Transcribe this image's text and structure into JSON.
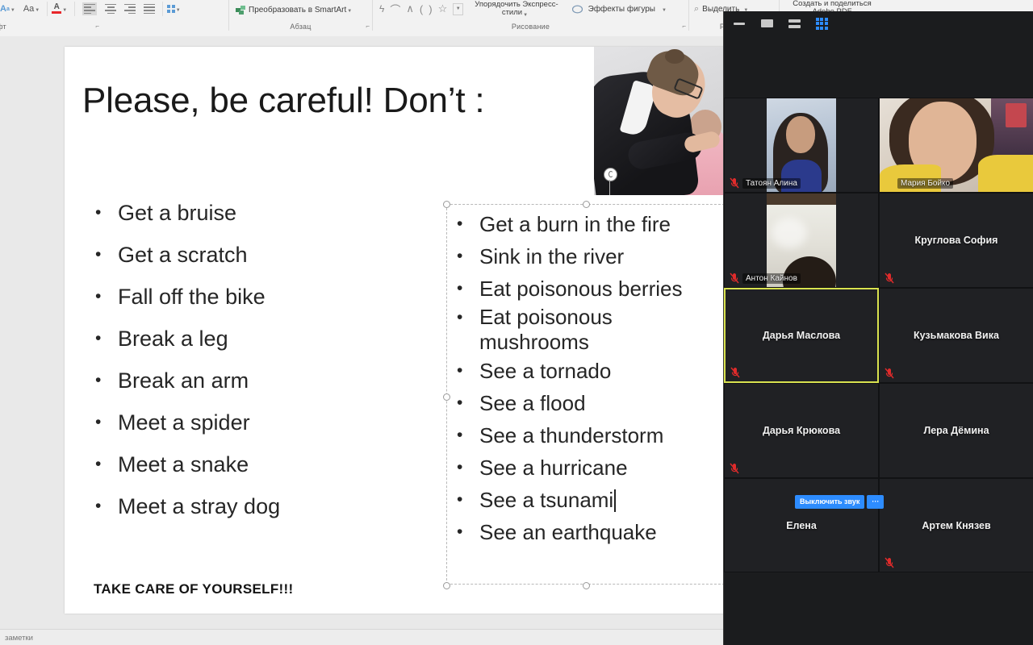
{
  "app": {
    "host_app": "PowerPoint",
    "overlay_app": "Zoom"
  },
  "ribbon": {
    "groups": [
      {
        "label": "фт",
        "launcher": "⌐"
      },
      {
        "label": "Абзац",
        "launcher": "⌐"
      },
      {
        "label": "Рисование",
        "launcher": "⌐"
      },
      {
        "label": "Редакти",
        "launcher": ""
      }
    ],
    "buttons": {
      "clear_formatting": "Aa",
      "change_case": "Aa",
      "text_color": "A",
      "columns": "columns",
      "smartart": "Преобразовать в SmartArt",
      "quick_styles_line1": "Упорядочить Экспресс-",
      "quick_styles_line2": "стили",
      "shape_effects": "Эффекты фигуры",
      "select": "Выделить",
      "adobe_line1": "Создать и поделиться",
      "adobe_line2": "Adobe PDF"
    }
  },
  "slide": {
    "title": "Please, be careful! Don’t :",
    "left_bullets": [
      "Get a bruise",
      "Get a scratch",
      "Fall off the bike",
      "Break a leg",
      "Break an arm",
      "Meet a spider",
      "Meet a snake",
      "Meet a stray dog"
    ],
    "right_bullets": [
      "Get a burn in the fire",
      "Sink in the river",
      "Eat poisonous berries",
      "Eat poisonous mushrooms",
      "See a tornado",
      "See a flood",
      "See a thunderstorm",
      "See a hurricane",
      "See a tsunami",
      "See an earthquake"
    ],
    "cursor_after_bullet_index": 8,
    "footer": "TAKE CARE OF YOURSELF!!!",
    "image_alt": "teacher-pointing-finger-photo"
  },
  "status_bar": {
    "notes_label": "заметки"
  },
  "zoom_window": {
    "toolbar": {
      "minimize": "minimize-icon",
      "single_view": "single-view-icon",
      "split_view": "split-view-icon",
      "gallery_view": "gallery-view-icon"
    },
    "mute_controls": {
      "mute_label": "Выключить звук",
      "more_label": "···"
    },
    "accent_color": "#2d8cff",
    "active_border_color": "#d9e24f",
    "participants": [
      {
        "name": "Татоян Алина",
        "video": true,
        "muted": true,
        "active": false,
        "cam": "cam-a"
      },
      {
        "name": "Мария Бойко",
        "video": true,
        "muted": false,
        "active": false,
        "cam": "cam-b"
      },
      {
        "name": "Антон Кайнов",
        "video": true,
        "muted": true,
        "active": false,
        "cam": "cam-c"
      },
      {
        "name": "Круглова София",
        "video": false,
        "muted": true,
        "active": false,
        "cam": ""
      },
      {
        "name": "Дарья Маслова",
        "video": false,
        "muted": true,
        "active": true,
        "cam": ""
      },
      {
        "name": "Кузьмакова Вика",
        "video": false,
        "muted": true,
        "active": false,
        "cam": ""
      },
      {
        "name": "Дарья Крюкова",
        "video": false,
        "muted": true,
        "active": false,
        "cam": ""
      },
      {
        "name": "Лера Дёмина",
        "video": false,
        "muted": false,
        "active": false,
        "cam": ""
      },
      {
        "name": "Елена",
        "video": false,
        "muted": false,
        "active": false,
        "cam": ""
      },
      {
        "name": "Артем Князев",
        "video": false,
        "muted": true,
        "active": false,
        "cam": ""
      }
    ]
  }
}
